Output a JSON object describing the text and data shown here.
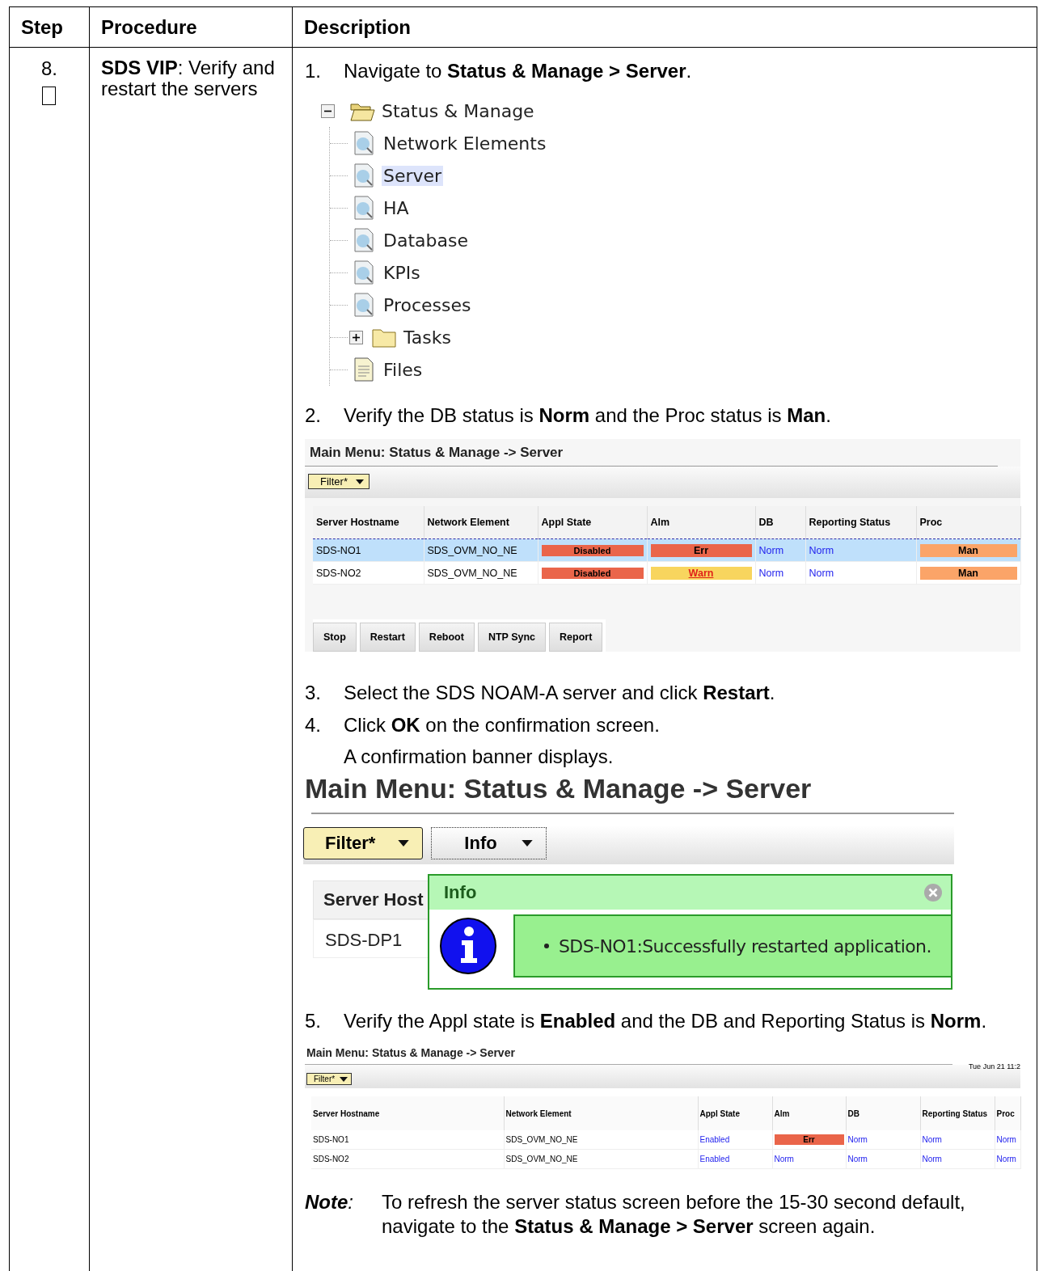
{
  "table": {
    "columns": [
      "Step",
      "Procedure",
      "Description"
    ],
    "row": {
      "step": "8.",
      "checked": false,
      "procedure": "**SDS VIP**:  Verify and restart the servers",
      "description": [
        {
          "kind": "instruction",
          "number": "1.",
          "text": "Navigate to **Status & Manage > Server**."
        },
        {
          "kind": "tree",
          "items": [
            {
              "label": "Status & Manage",
              "kind": "folder-open",
              "expanded": true,
              "selected": false,
              "children": [
                {
                  "label": "Network Elements",
                  "kind": "page",
                  "selected": false
                },
                {
                  "label": "Server",
                  "kind": "page",
                  "selected": true
                },
                {
                  "label": "HA",
                  "kind": "page",
                  "selected": false
                },
                {
                  "label": "Database",
                  "kind": "page",
                  "selected": false
                },
                {
                  "label": "KPIs",
                  "kind": "page",
                  "selected": false
                },
                {
                  "label": "Processes",
                  "kind": "page",
                  "selected": false
                },
                {
                  "label": "Tasks",
                  "kind": "folder",
                  "expanded": false,
                  "selected": false
                },
                {
                  "label": "Files",
                  "kind": "file",
                  "selected": false
                }
              ]
            }
          ]
        },
        {
          "kind": "instruction",
          "number": "2.",
          "text": "Verify the DB status is **Norm** and the Proc status is **Man**."
        },
        {
          "kind": "screen",
          "title": "Main Menu: Status & Manage -> Server",
          "filter": "Filter*",
          "columns": [
            "Server Hostname",
            "Network Element",
            "Appl State",
            "Alm",
            "DB",
            "Reporting Status",
            "Proc"
          ],
          "rows": [
            {
              "selected": true,
              "cells": [
                {
                  "kind": "text",
                  "text": "SDS-NO1"
                },
                {
                  "kind": "text",
                  "text": "SDS_OVM_NO_NE"
                },
                {
                  "kind": "disabled",
                  "text": "Disabled"
                },
                {
                  "kind": "err",
                  "text": "Err"
                },
                {
                  "kind": "link",
                  "text": "Norm"
                },
                {
                  "kind": "link",
                  "text": "Norm"
                },
                {
                  "kind": "man",
                  "text": "Man"
                }
              ]
            },
            {
              "selected": false,
              "cells": [
                {
                  "kind": "text",
                  "text": "SDS-NO2"
                },
                {
                  "kind": "text",
                  "text": "SDS_OVM_NO_NE"
                },
                {
                  "kind": "disabled",
                  "text": "Disabled"
                },
                {
                  "kind": "warn",
                  "text": "Warn"
                },
                {
                  "kind": "link",
                  "text": "Norm"
                },
                {
                  "kind": "link",
                  "text": "Norm"
                },
                {
                  "kind": "man",
                  "text": "Man"
                }
              ]
            }
          ],
          "buttons": [
            "Stop",
            "Restart",
            "Reboot",
            "NTP Sync",
            "Report"
          ]
        },
        {
          "kind": "instruction",
          "number": "3.",
          "text": "Select the SDS NOAM-A server and click **Restart**."
        },
        {
          "kind": "instruction",
          "number": "4.",
          "text": "Click **OK** on the confirmation screen."
        },
        {
          "kind": "plain",
          "text": "A confirmation banner displays."
        },
        {
          "kind": "banner_screen",
          "title": "Main Menu: Status & Manage -> Server",
          "filter": "Filter*",
          "dropdown": "Info",
          "column": "Server Host",
          "cell": "SDS-DP1",
          "banner": {
            "title": "Info",
            "messages": [
              "SDS-NO1:Successfully restarted application."
            ]
          }
        },
        {
          "kind": "instruction",
          "number": "5.",
          "text": "Verify the Appl state is **Enabled** and the DB and Reporting Status is **Norm**."
        },
        {
          "kind": "compact_screen",
          "title": "Main Menu: Status & Manage -> Server",
          "timestamp": "Tue Jun 21 11:2",
          "filter": "Filter*",
          "columns": [
            "Server Hostname",
            "Network Element",
            "Appl State",
            "Alm",
            "DB",
            "Reporting Status",
            "Proc"
          ],
          "rows": [
            {
              "selected": false,
              "cells": [
                {
                  "kind": "text",
                  "text": "SDS-NO1"
                },
                {
                  "kind": "text",
                  "text": "SDS_OVM_NO_NE"
                },
                {
                  "kind": "link",
                  "text": "Enabled"
                },
                {
                  "kind": "err",
                  "text": "Err"
                },
                {
                  "kind": "link",
                  "text": "Norm"
                },
                {
                  "kind": "link",
                  "text": "Norm"
                },
                {
                  "kind": "link",
                  "text": "Norm"
                }
              ]
            },
            {
              "selected": false,
              "cells": [
                {
                  "kind": "text",
                  "text": "SDS-NO2"
                },
                {
                  "kind": "text",
                  "text": "SDS_OVM_NO_NE"
                },
                {
                  "kind": "link",
                  "text": "Enabled"
                },
                {
                  "kind": "link",
                  "text": "Norm"
                },
                {
                  "kind": "link",
                  "text": "Norm"
                },
                {
                  "kind": "link",
                  "text": "Norm"
                },
                {
                  "kind": "link",
                  "text": "Norm"
                }
              ]
            }
          ]
        },
        {
          "kind": "note",
          "label": "**Note**:",
          "text": "To refresh the server status screen before the 15-30 second default, navigate to the **Status & Manage > Server** screen again."
        }
      ]
    }
  }
}
